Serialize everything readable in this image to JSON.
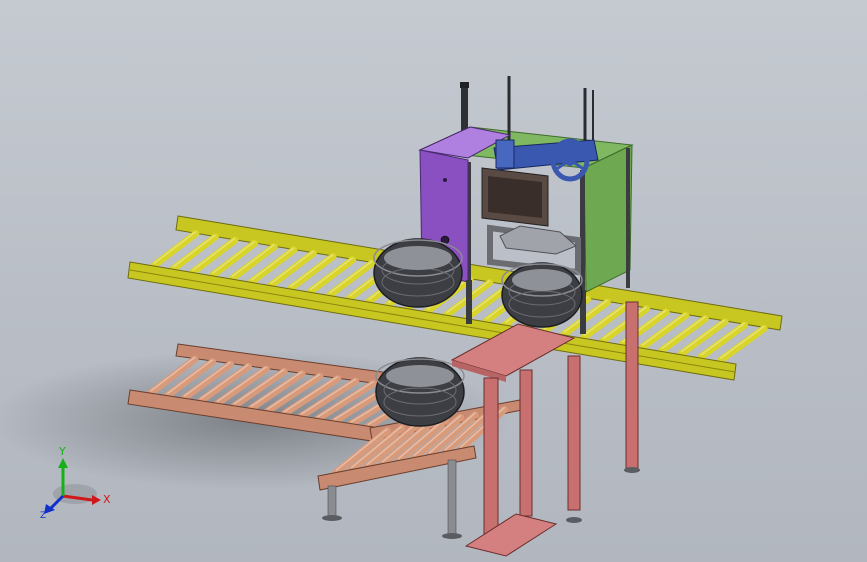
{
  "viewport": {
    "background_top": "#c5cad1",
    "background_bottom": "#b2b7bf"
  },
  "triad": {
    "x_label": "X",
    "y_label": "Y",
    "z_label": "Z",
    "x_color": "#d01818",
    "y_color": "#18b018",
    "z_color": "#1030c8"
  },
  "colors": {
    "roller_yellow": "#d9d42a",
    "frame_yellow": "#c8c620",
    "roller_salmon": "#d99a7a",
    "frame_salmon": "#c88a70",
    "cabinet_purple": "#8a4fc0",
    "frame_green": "#7fb860",
    "handwheel_blue": "#3a58b0",
    "stand_pink": "#d48080",
    "rim_dark": "#4a4c52"
  }
}
